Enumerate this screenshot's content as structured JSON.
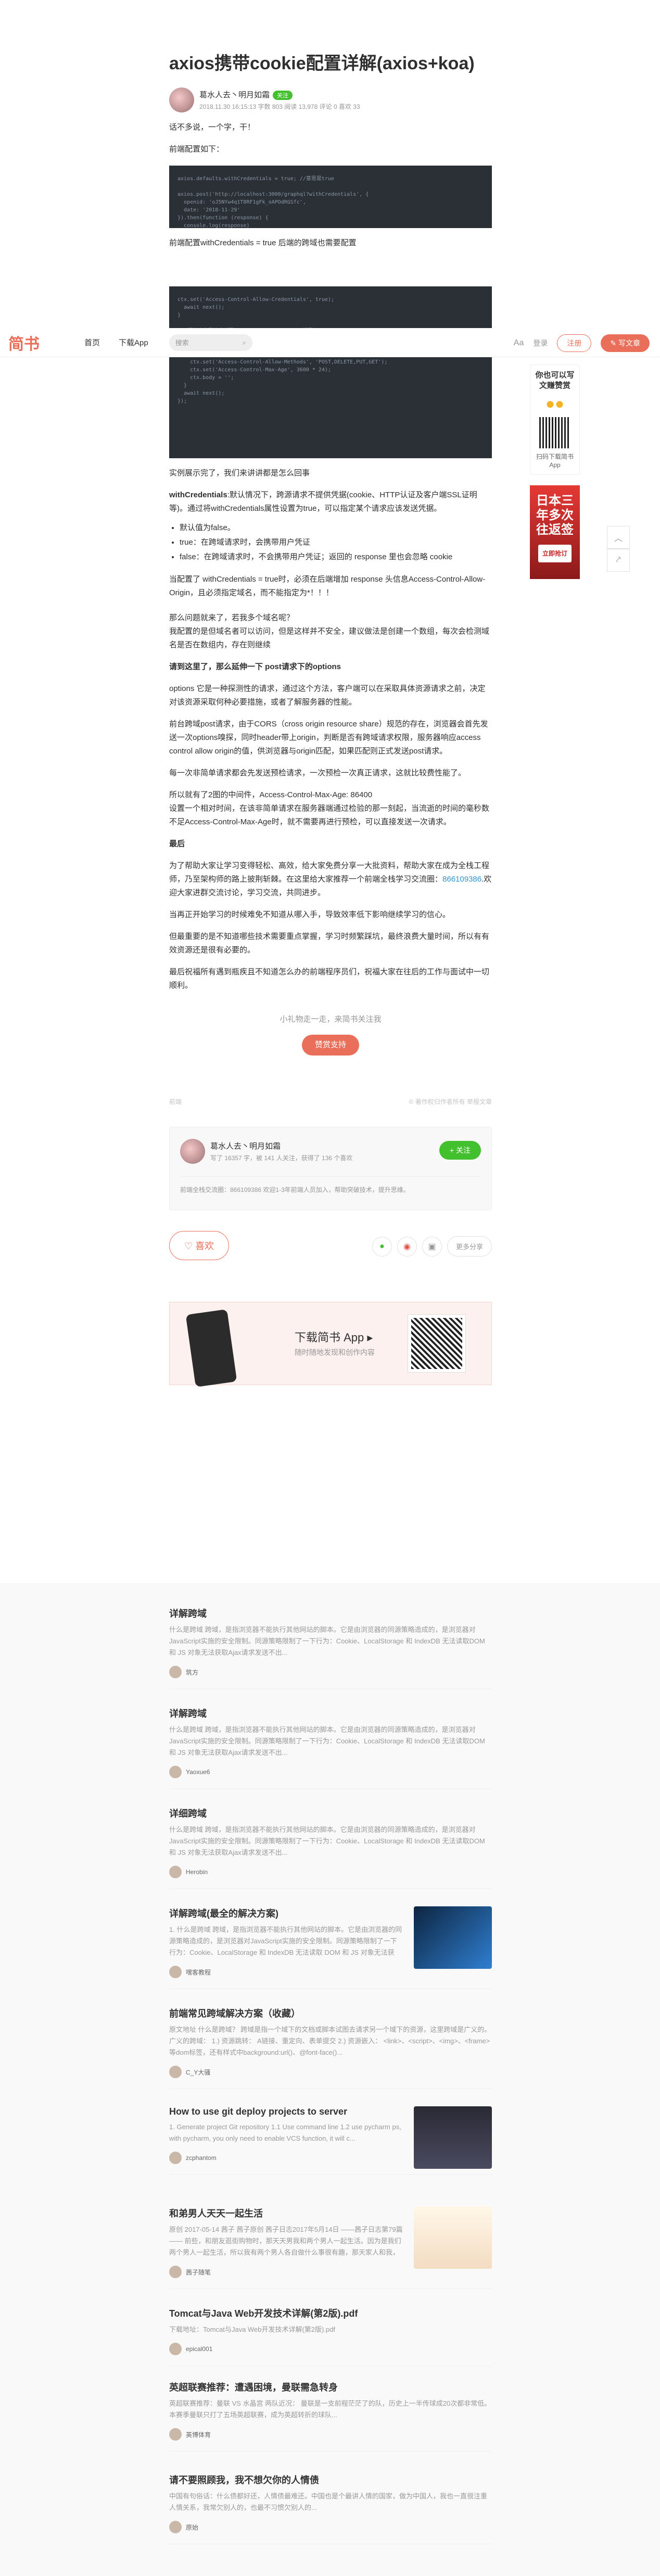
{
  "header": {
    "logo": "简书",
    "nav": [
      "首页",
      "下载App"
    ],
    "search_placeholder": "搜索",
    "aa": "Aa",
    "login": "登录",
    "register": "注册",
    "write": "写文章"
  },
  "article": {
    "title": "axios携带cookie配置详解(axios+koa)",
    "author": "葛水人去丶明月如霜",
    "follow_badge": "关注",
    "meta": "2018.11.30 16:15:13  字数 803  阅读 13,978  评论 0  喜欢 33",
    "paragraphs": [
      "话不多说，一个字，干！",
      "前端配置如下：",
      "前端配置withCredentials = true 后端的跨域也需要配置",
      "实例展示完了，我们来讲讲都是怎么回事",
      "默认值为false。",
      "true：在跨域请求时，会携带用户凭证",
      "false：在跨域请求时，不会携带用户凭证；返回的 response 里也会忽略 cookie",
      "当配置了 withCredentials = true时，必须在后端增加 response 头信息Access-Control-Allow-Origin，且必须指定域名，而不能指定为*！！！",
      "那么问题就来了，若我多个域名呢？",
      "我配置的是但域名者可以访问，但是这样并不安全，建议做法是创建一个数组，每次会检测域名是否在数组内，存在则继续",
      "请到这里了，那么延伸一下 post请求下的options",
      "options 它是一种探测性的请求，通过这个方法，客户端可以在采取具体资源请求之前，决定对该资源采取何种必要措施，或者了解服务器的性能。",
      "前台跨域post请求，由于CORS（cross origin resource share）规范的存在，浏览器会首先发送一次options嗅探，同时header带上origin，判断是否有跨域请求权限，服务器响应access control allow origin的值，供浏览器与origin匹配，如果匹配则正式发送post请求。",
      "每一次非简单请求都会先发送预检请求，一次预检一次真正请求，这就比较费性能了。",
      "所以就有了2图的中间件，Access-Control-Max-Age: 86400",
      "设置一个相对时间，在该非简单请求在服务器端通过检验的那一刻起，当流逝的时间的毫秒数不足Access-Control-Max-Age时，就不需要再进行预检，可以直接发送一次请求。",
      "最后",
      "当再正开始学习的时候难免不知道从哪入手，导致效率低下影响继续学习的信心。",
      "但最重要的是不知道哪些技术需要重点掌握，学习时频繁踩坑，最终浪费大量时间，所以有有效资源还是很有必要的。",
      "最后祝福所有遇到瓶疾且不知道怎么办的前端程序员们，祝福大家在往后的工作与面试中一切顺利。"
    ],
    "cred_label": "withCredentials",
    "cred_text": ":默认情况下，跨源请求不提供凭据(cookie、HTTP认证及客户端SSL证明等)。通过将withCredentials属性设置为true，可以指定某个请求应该发送凭据。",
    "study_text": "为了帮助大家让学习变得轻松、高效，给大家免费分享一大批资料，帮助大家在成为全栈工程师，乃至架构师的路上披荆斩棘。在这里给大家推荐一个前端全栈学习交流圈：",
    "study_link": "866109386",
    "study_text2": ".欢迎大家进群交流讨论，学习交流，共同进步。",
    "code1": "axios.defaults.withCredentials = true; //意思是true\n\naxios.post('http://localhost:3000/graphql?withCredentials', {\n  openid: 'oJ5NYw4q1T8RF1gFk_oAPOdRGSfc',\n  date: '2018-11-29'\n}).then(function (response) {\n  console.log(response)\n})",
    "code2": "ctx.set('Access-Control-Allow-Credentials', true);\n  await next();\n}\n\n// 预检请求是请求返回Access-Control-Max-Age设置Access-Control-Max-Age\n// 设置一个相对时间在该非简单请求发送之前，只需要一次预检就可以了\napp.use(async (ctx, next) => {\n  if (ctx.method === 'OPTIONS') {\n    ctx.set('Access-Control-Allow-Methods', 'POST,DELETE,PUT,GET');\n    ctx.set('Access-Control-Max-Age', 3600 * 24);\n    ctx.body = '';\n  }\n  await next();\n});",
    "support_text": "小礼物走一走，来简书关注我",
    "support_btn": "赞赏支持",
    "footer_left": "前端",
    "footer_right": "© 著作权归作者所有  举报文章",
    "card_author": "葛水人去丶明月如霜",
    "card_meta": "写了 16357 字，被 141 人关注，获得了 136 个喜欢",
    "card_follow": "+ 关注",
    "card_desc": "前端全栈交流圈：866109386 欢迎1-3年前端人员加入，帮助突破技术，提升思维。",
    "like": "喜欢",
    "more_share": "更多分享",
    "app_title": "下载简书 App ▸",
    "app_sub": "随时随地发现和创作内容"
  },
  "sidebar": {
    "promo": "你也可以写文赚赞赏",
    "download": "扫码下载简书App",
    "ad_text": "日本三年多次往返签",
    "ad_btn": "立即抢订"
  },
  "recommendations": [
    {
      "title": "详解跨域",
      "desc": "什么是跨域 跨域，是指浏览器不能执行其他网站的脚本。它是由浏览器的同源策略造成的，是浏览器对JavaScript实施的安全限制。同源策略限制了一下行为：Cookie、LocalStorage 和 IndexDB 无法读取DOM 和 JS 对象无法获取Ajax请求发送不出...",
      "author": "筑方"
    },
    {
      "title": "详解跨域",
      "desc": "什么是跨域 跨域，是指浏览器不能执行其他网站的脚本。它是由浏览器的同源策略造成的，是浏览器对JavaScript实施的安全限制。同源策略限制了一下行为：Cookie、LocalStorage 和 IndexDB 无法读取DOM 和 JS 对象无法获取Ajax请求发送不出...",
      "author": "Yaoxue6"
    },
    {
      "title": "详细跨域",
      "desc": "什么是跨域 跨域，是指浏览器不能执行其他网站的脚本。它是由浏览器的同源策略造成的，是浏览器对JavaScript实施的安全限制。同源策略限制了一下行为：Cookie、LocalStorage 和 IndexDB 无法读取DOM 和 JS 对象无法获取Ajax请求发送不出...",
      "author": "Herobin"
    },
    {
      "title": "详解跨域(最全的解决方案)",
      "desc": "1. 什么是跨域 跨域，是指浏览器不能执行其他网站的脚本。它是由浏览器的同源策略造成的，是浏览器对JavaScript实施的安全限制。同源策略限制了一下行为：Cookie、LocalStorage 和 IndexDB 无法读取 DOM 和 JS 对象无法获取...",
      "author": "嘿客教程"
    },
    {
      "title": "前端常见跨域解决方案（收藏）",
      "desc": "原文地址 什么是跨域？ 跨域是指一个域下的文档或脚本试图去请求另一个域下的资源，这里跨域是广义的。广义的跨域： 1.) 资源跳转： A链接、重定向、表单提交 2.) 资源嵌入： <link>、<script>、<img>、<frame>等dom标签，还有样式中background:url()、@font-face()...",
      "author": "C_Y大骚"
    },
    {
      "title": "How to use git deploy projects to server",
      "desc": "1. Generate project Git repository 1.1 Use command line 1.2 use pycharm ps, with pycharm, you only need to enable VCS function, it will c...",
      "author": "zcphantom"
    },
    {
      "title": "和弟男人天天一起生活",
      "desc": "原创 2017-05-14 茜子 茜子原创 茜子日志2017年5月14日 ——茜子日志第79篇—— 前些，和朋友逛街购物时，那天天男我和两个男人一起生活。因为是我们两个男人一起生活，所以我有两个男人各自做什么事很有趣，那天家人和我，以我们家三个男人的生活为...",
      "author": "茜子随笔"
    },
    {
      "title": "Tomcat与Java Web开发技术详解(第2版).pdf",
      "desc": "下载地址：Tomcat与Java Web开发技术详解(第2版).pdf",
      "author": "epical001"
    },
    {
      "title": "英超联赛推荐：遭遇困境，曼联需急转身",
      "desc": "英超联赛推荐：曼联 VS 水晶宫 两队近况： 曼联是一支前程茫茫了的队，历史上一半传球成20次都非常低。本赛季曼联只打了五场英超联赛，成为英超转折的球队...",
      "author": "英博体育"
    },
    {
      "title": "请不要照顾我，我不想欠你的人情债",
      "desc": "中国有句俗话：什么债都好还，人情债最难还。中国也是个最讲人情的国家，做为中国人，我也一直很注重人情关系，我常欠别人的，也最不习惯欠别人的...",
      "author": "原始"
    }
  ]
}
